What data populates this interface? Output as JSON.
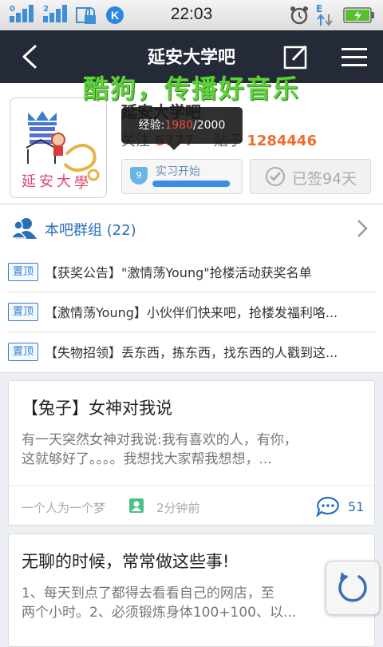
{
  "status_bar": {
    "sim1_label": "0",
    "sim2_label": "2",
    "time": "22:03",
    "data_label": "E",
    "icons": [
      "signal-icon",
      "lock-icon",
      "kugou-k-icon",
      "alarm-icon",
      "data-transfer-icon",
      "battery-charging-icon"
    ]
  },
  "nav": {
    "title": "延安大学吧",
    "back_icon": "back-arrow-icon",
    "compose_icon": "compose-icon",
    "menu_icon": "menu-icon"
  },
  "overlay_banner": "酷狗，传播好音乐",
  "header": {
    "bar_name": "延安大学吧",
    "follow_label": "关注",
    "follow_count": "6777",
    "posts_label": "贴子",
    "posts_count": "1284446",
    "tooltip_label": "经验:",
    "tooltip_current": "1980",
    "tooltip_total": "/2000",
    "level_number": "9",
    "level_name": "实习开始",
    "level_progress": 0.99,
    "signed_text": "已签94天"
  },
  "group": {
    "label": "本吧群组 (22)"
  },
  "top_posts": {
    "tag": "置顶",
    "items": [
      {
        "title": "【获奖公告】\"激情荡Young\"抢楼活动获奖名单"
      },
      {
        "title": "【激情荡Young】小伙伴们快来吧，抢楼发福利咯..."
      },
      {
        "title": "【失物招领】丢东西，拣东西，找东西的人戳到这..."
      }
    ]
  },
  "threads": [
    {
      "title": "【兔子】女神对我说",
      "body_line1": "有一天突然女神对我说:我有喜欢的人，有你，",
      "body_line2": "这就够好了。。。。我想找大家帮我想想，...",
      "author": "一个人为一个梦",
      "time": "2分钟前",
      "replies": "51"
    },
    {
      "title": "无聊的时候，常常做这些事!",
      "body_line1": "1、每天到点了都得去看看自己的网店，至",
      "body_line2": "两个小时。2、必须锻炼身体100+100、以..."
    }
  ],
  "colors": {
    "nav_bg": "#242a37",
    "accent_blue": "#2a6fb8",
    "count_orange": "#f06c2b",
    "banner_green": "#5ed13b"
  }
}
